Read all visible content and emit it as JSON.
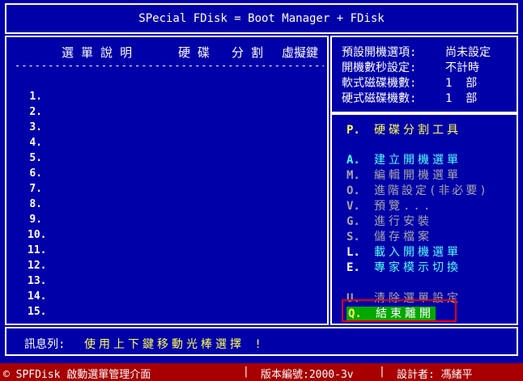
{
  "title": "SPecial FDisk = Boot Manager + FDisk",
  "menu": {
    "headers": [
      "選 單 說 明",
      "硬 碟",
      "分 割",
      "虛擬鍵"
    ],
    "rule": "-------------------------------------------------------",
    "entries": [
      "1.",
      "2.",
      "3.",
      "4.",
      "5.",
      "6.",
      "7.",
      "8.",
      "9.",
      "10.",
      "11.",
      "12.",
      "13.",
      "14.",
      "15."
    ]
  },
  "info": {
    "default_boot_label": "預設開機選項:",
    "default_boot_value": "尚未設定",
    "countdown_label": "開機數秒設定:",
    "countdown_value": "不計時",
    "floppy_label": "軟式磁碟機數:",
    "floppy_value": "1  部",
    "harddisk_label": "硬式磁碟機數:",
    "harddisk_value": "1  部"
  },
  "tools": [
    {
      "key": "P.",
      "label": "硬碟分割工具"
    },
    {
      "key": "A.",
      "label": "建立開機選單"
    },
    {
      "key": "M.",
      "label": "編輯開機選單"
    },
    {
      "key": "O.",
      "label": "進階設定(非必要)"
    },
    {
      "key": "V.",
      "label": "預覽..."
    },
    {
      "key": "G.",
      "label": "進行安裝"
    },
    {
      "key": "S.",
      "label": "儲存檔案"
    },
    {
      "key": "L.",
      "label": "載入開機選單"
    },
    {
      "key": "E.",
      "label": "專家模示切換"
    },
    {
      "key": "U.",
      "label": "清除選單設定"
    },
    {
      "key": "Q.",
      "label": "結束離開"
    }
  ],
  "status": {
    "label": "訊息列:",
    "message": "使用上下鍵移動光棒選擇 !"
  },
  "footer": {
    "app": "© SPFDisk 啟動選單管理介面",
    "version": "版本編號:2000-3v",
    "designer": "設計者: 馮緒平"
  },
  "colors": {
    "background": "#0000a8",
    "highlight": "#00a800",
    "footer_bg": "#a80000",
    "title_key": "#ffff55",
    "tool_text": "#55ffff"
  }
}
